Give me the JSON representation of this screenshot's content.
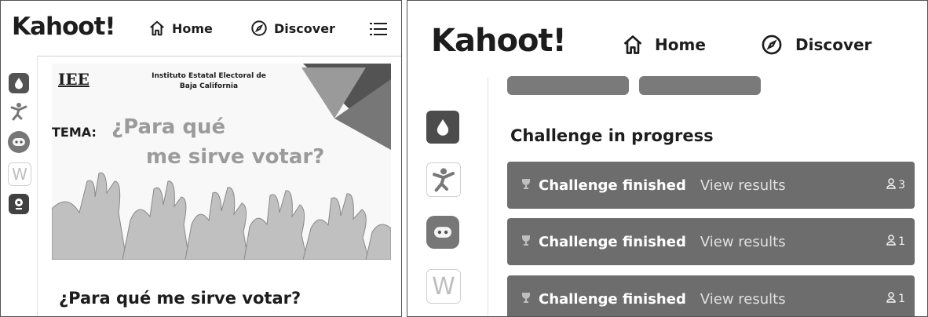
{
  "left": {
    "logo": "Kahoot!",
    "nav": {
      "home": "Home",
      "discover": "Discover"
    },
    "poster": {
      "org_logo": "IEE",
      "org_name_line1": "Instituto Estatal Electoral de",
      "org_name_line2": "Baja California",
      "tema_label": "TEMA:",
      "headline_line1": "¿Para qué",
      "headline_line2": "me sirve votar?"
    },
    "kahoot_title": "¿Para qué me sirve votar?"
  },
  "right": {
    "logo": "Kahoot!",
    "nav": {
      "home": "Home",
      "discover": "Discover"
    },
    "section_title": "Challenge in progress",
    "challenges": [
      {
        "status": "Challenge finished",
        "link": "View results",
        "players": "3"
      },
      {
        "status": "Challenge finished",
        "link": "View results",
        "players": "1"
      },
      {
        "status": "Challenge finished",
        "link": "View results",
        "players": "1"
      }
    ]
  },
  "icons": {
    "sidebar": [
      "drop-icon",
      "person-icon",
      "robot-icon",
      "w-icon",
      "pin-icon"
    ],
    "nav": [
      "home-icon",
      "compass-icon",
      "list-icon"
    ]
  },
  "colors": {
    "row_bg": "#6e6e6e",
    "text_dark": "#222222"
  }
}
